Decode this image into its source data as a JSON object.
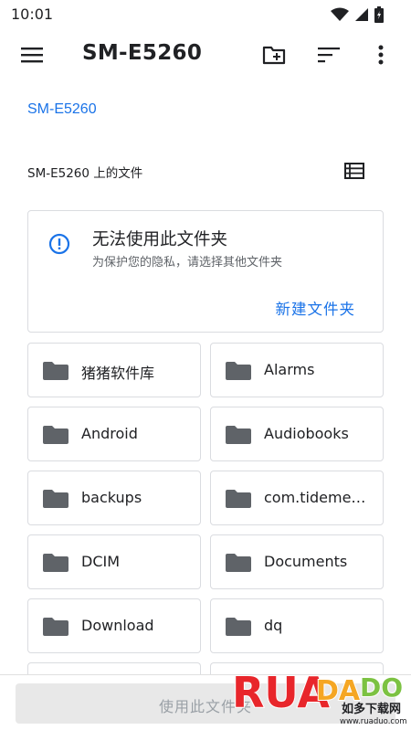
{
  "status_bar": {
    "time": "10:01"
  },
  "app_bar": {
    "title": "SM-E5260"
  },
  "breadcrumb": {
    "root": "SM-E5260"
  },
  "section": {
    "title": "SM-E5260 上的文件"
  },
  "warning": {
    "title": "无法使用此文件夹",
    "subtitle": "为保护您的隐私，请选择其他文件夹",
    "action": "新建文件夹"
  },
  "folders": [
    {
      "name": "猪猪软件库"
    },
    {
      "name": "Alarms"
    },
    {
      "name": "Android"
    },
    {
      "name": "Audiobooks"
    },
    {
      "name": "backups"
    },
    {
      "name": "com.tidemedia.huangshan"
    },
    {
      "name": "DCIM"
    },
    {
      "name": "Documents"
    },
    {
      "name": "Download"
    },
    {
      "name": "dq"
    }
  ],
  "bottom": {
    "button_label": "使用此文件夹"
  },
  "watermark": {
    "logo_text": "RUANDADO",
    "sub_text": "如多下载网",
    "url": "www.ruaduo.com"
  },
  "colors": {
    "accent": "#1a73e8",
    "text": "#202124",
    "muted": "#5f6368",
    "border": "#dadce0",
    "icon": "#5f6368"
  }
}
